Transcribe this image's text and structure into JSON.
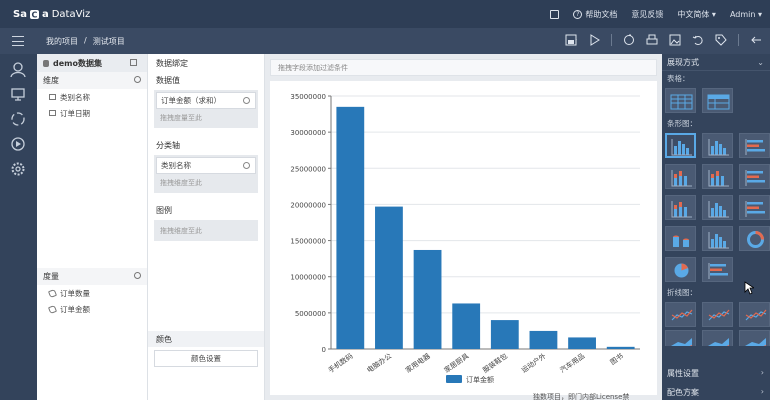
{
  "app": {
    "logo_bold": "Sa",
    "logo_bold2": "a",
    "logo_name": "DataViz"
  },
  "topbar": {
    "help": "帮助文档",
    "feedback": "意见反馈",
    "language": "中文简体 ▾",
    "user": "Admin ▾"
  },
  "breadcrumb": {
    "project": "我的项目",
    "sep": "/",
    "current": "测试项目"
  },
  "dataset": {
    "name": "demo数据集",
    "dimension_label": "维度",
    "dimensions": [
      "类别名称",
      "订单日期"
    ],
    "measure_label": "度量",
    "measures": [
      "订单数量",
      "订单金额"
    ]
  },
  "binding": {
    "header": "数据绑定",
    "value_title": "数据值",
    "value_field": "订单金额（求和）",
    "value_drop": "拖拽度量至此",
    "axis_title": "分类轴",
    "axis_field": "类别名称",
    "axis_drop": "拖拽维度至此",
    "legend_title": "图例",
    "legend_drop": "拖拽维度至此",
    "color_title": "颜色",
    "color_button": "颜色设置"
  },
  "canvas": {
    "filter_placeholder": "拖拽字段添加过滤条件",
    "footnote": "独数项目，即门内部License禁"
  },
  "right_panel": {
    "header": "展现方式",
    "table_section": "表格：",
    "bar_section": "条形图：",
    "line_section": "折线图：",
    "properties": "属性设置",
    "color_scheme": "配色方案"
  },
  "colors": {
    "bar": "#2878b8",
    "selected": "#5aa9e6"
  },
  "chart_data": {
    "type": "bar",
    "categories": [
      "手机数码",
      "电脑办公",
      "家用电器",
      "家居厨具",
      "服装鞋包",
      "运动户外",
      "汽车用品",
      "图书"
    ],
    "series": [
      {
        "name": "订单金额",
        "values": [
          33500000,
          19700000,
          13700000,
          6300000,
          4000000,
          2500000,
          1600000,
          300000
        ]
      }
    ],
    "ylim": [
      0,
      35000000
    ],
    "yticks": [
      "0",
      "5000000",
      "10000000",
      "15000000",
      "20000000",
      "25000000",
      "30000000",
      "35000000"
    ],
    "grid": true,
    "legend": "bottom"
  }
}
